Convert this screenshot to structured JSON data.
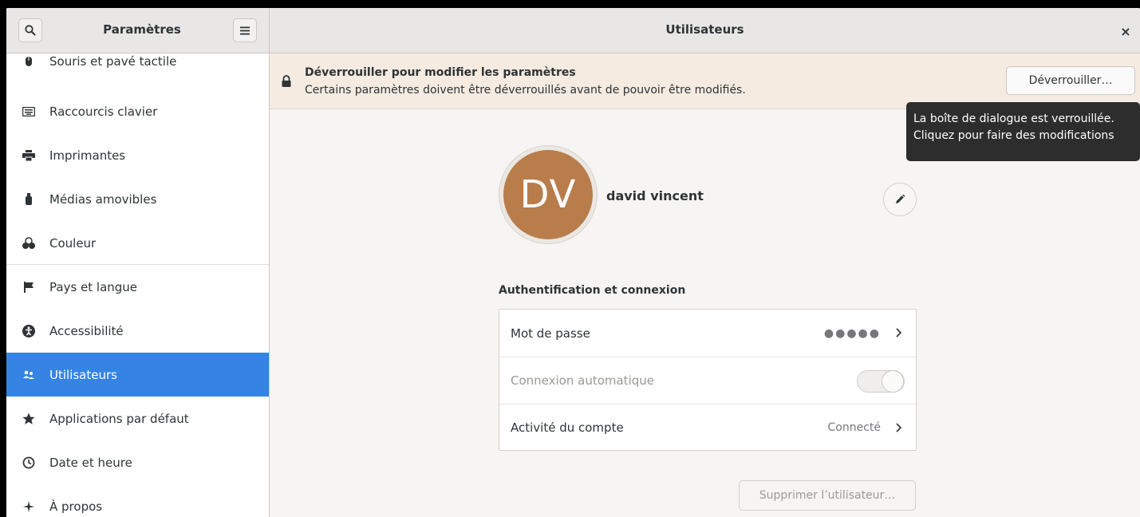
{
  "headerbar": {
    "sidebar_title": "Paramètres",
    "main_title": "Utilisateurs",
    "close_glyph": "×",
    "search_icon": "search-icon",
    "menu_icon": "hamburger-menu-icon"
  },
  "sidebar": {
    "items": [
      {
        "label": "Souris et pavé tactile",
        "icon": "mouse-icon"
      },
      {
        "label": "Raccourcis clavier",
        "icon": "keyboard-icon"
      },
      {
        "label": "Imprimantes",
        "icon": "printer-icon"
      },
      {
        "label": "Médias amovibles",
        "icon": "removable-media-icon"
      },
      {
        "label": "Couleur",
        "icon": "color-icon"
      },
      {
        "label": "Pays et langue",
        "icon": "flag-icon"
      },
      {
        "label": "Accessibilité",
        "icon": "accessibility-icon"
      },
      {
        "label": "Utilisateurs",
        "icon": "users-icon",
        "active": true
      },
      {
        "label": "Applications par défaut",
        "icon": "star-icon"
      },
      {
        "label": "Date et heure",
        "icon": "clock-icon"
      },
      {
        "label": "À propos",
        "icon": "sparkle-icon"
      }
    ]
  },
  "infobar": {
    "title": "Déverrouiller pour modifier les paramètres",
    "subtitle": "Certains paramètres doivent être déverrouillés avant de pouvoir être modifiés.",
    "unlock_label": "Déverrouiller…"
  },
  "tooltip": {
    "line1": "La boîte de dialogue est verrouillée.",
    "line2": "Cliquez pour faire des modifications"
  },
  "user": {
    "initials": "DV",
    "name": "david vincent",
    "avatar_color": "#b87d4b"
  },
  "auth": {
    "section_title": "Authentification et connexion",
    "password_label": "Mot de passe",
    "password_value": "●●●●●",
    "autologin_label": "Connexion automatique",
    "autologin_enabled": false,
    "activity_label": "Activité du compte",
    "activity_value": "Connecté"
  },
  "actions": {
    "delete_label": "Supprimer l’utilisateur…"
  },
  "colors": {
    "accent": "#3584e4",
    "infobar_bg": "#f5ebe1",
    "tooltip_bg": "#2d2d2d"
  }
}
